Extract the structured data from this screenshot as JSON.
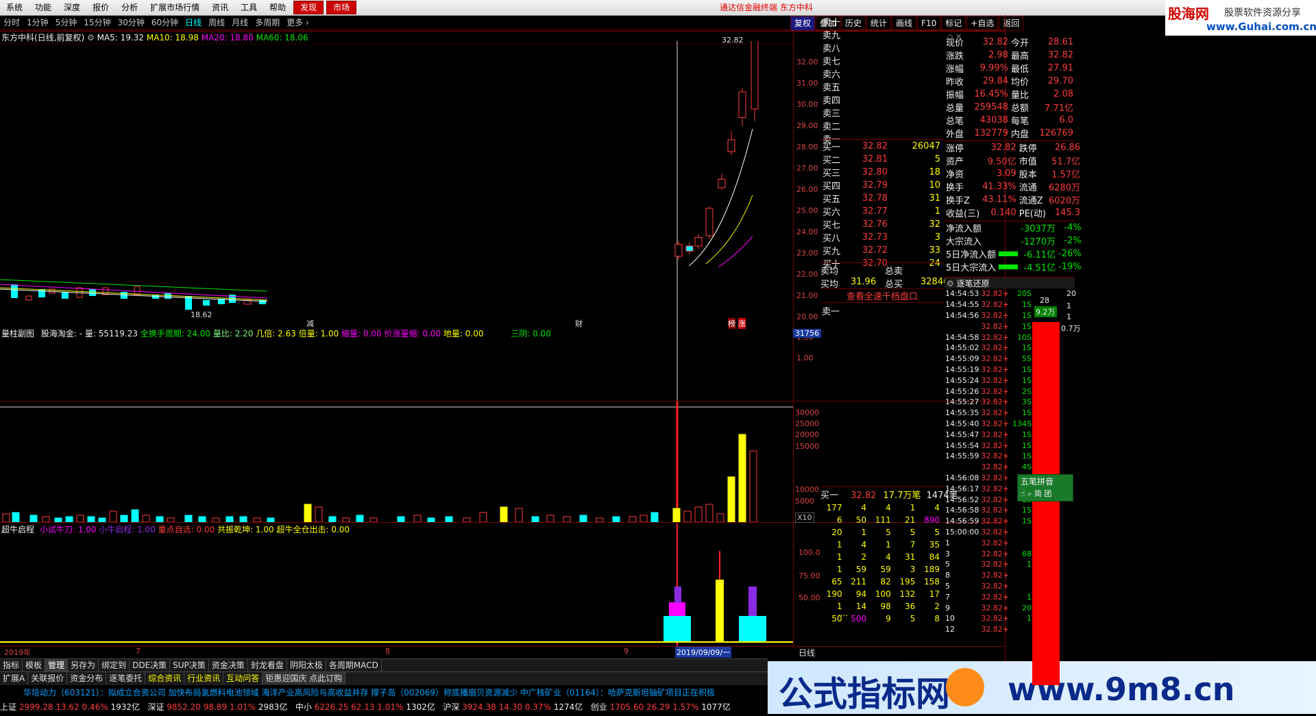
{
  "menubar": {
    "items": [
      "系统",
      "功能",
      "深度",
      "报价",
      "分析",
      "扩展市场行情",
      "资讯",
      "工具",
      "帮助"
    ],
    "tags": [
      "发现",
      "市场"
    ],
    "title": "通达信金融终端  东方中科"
  },
  "logo": {
    "brand": "股海网",
    "slogan": "股票软件资源分享",
    "url": "www.Guhai.com.cn"
  },
  "period_bar": {
    "items": [
      "分时",
      "1分钟",
      "5分钟",
      "15分钟",
      "30分钟",
      "60分钟",
      "日线",
      "周线",
      "月线",
      "多周期",
      "更多 ›"
    ],
    "active": "日线"
  },
  "right_buttons": [
    "复权",
    "叠加",
    "历史",
    "统计",
    "画线",
    "F10",
    "标记",
    "+自选",
    "返回"
  ],
  "chart_header": {
    "stock": "东方中科(日线,前复权)",
    "ma5": "MA5: 19.32",
    "ma10": "MA10: 18.98",
    "ma20": "MA20: 18.80",
    "ma60": "MA60: 18.06"
  },
  "price_axis": [
    "32.00",
    "31.00",
    "30.00",
    "29.00",
    "28.00",
    "27.00",
    "26.00",
    "25.00",
    "24.00",
    "23.00",
    "22.00",
    "21.00",
    "20.00",
    "1.00",
    "1.00"
  ],
  "price_marks": {
    "high": "32.82",
    "low": "18.62"
  },
  "event_marks": [
    "减",
    "财",
    "榜",
    "涨"
  ],
  "volume_header": {
    "title": "量柱副图",
    "text1": "股海淘金: -",
    "text2": "量: 55119.23",
    "text3": "全换手周期: 24.00",
    "text4": "量比: 2.20",
    "text5": "几倍: 2.63",
    "text6": "倍量: 1.00",
    "text7": "缩量: 0.00",
    "text8": "价涨量缩: 0.00",
    "text9": "地量: 0.00",
    "text10": "三阴: 0.00",
    "current": "31756",
    "unit": "X10"
  },
  "volume_axis": [
    "30000",
    "25000",
    "20000",
    "15000",
    "10000",
    "5000"
  ],
  "indicator_header": {
    "title": "超牛启程",
    "a": "小试牛刀: 1.00",
    "b": "小牛启程: 1.00",
    "c": "重点自选: 0.00",
    "d": "共振乾坤: 1.00",
    "e": "超牛全仓出击: 0.00"
  },
  "indicator_axis": [
    "100.0",
    "75.00",
    "50.00"
  ],
  "time_axis": {
    "labels": [
      "2019年",
      "7",
      "8",
      "9"
    ],
    "cursor": "2019/09/09/一",
    "period": "日线"
  },
  "chart_data": {
    "type": "candlestick",
    "title": "东方中科(日线,前复权)",
    "recent_candles": [
      {
        "open": 20.0,
        "close": 20.7,
        "high": 20.9,
        "low": 19.8
      },
      {
        "open": 20.3,
        "close": 20.6,
        "high": 20.8,
        "low": 20.1
      },
      {
        "open": 20.6,
        "close": 21.1,
        "high": 21.3,
        "low": 20.4
      },
      {
        "open": 21.2,
        "close": 22.8,
        "high": 22.9,
        "low": 21.0
      },
      {
        "open": 24.0,
        "close": 24.5,
        "high": 24.8,
        "low": 23.9
      },
      {
        "open": 26.1,
        "close": 26.8,
        "high": 27.3,
        "low": 25.9
      },
      {
        "open": 28.1,
        "close": 29.6,
        "high": 29.8,
        "low": 27.6
      },
      {
        "open": 28.6,
        "close": 32.82,
        "high": 32.82,
        "low": 27.9
      }
    ],
    "ylim": [
      18,
      33
    ]
  },
  "quote": {
    "ask_labels": [
      "卖十",
      "卖九",
      "卖八",
      "卖七",
      "卖六",
      "卖五",
      "卖四",
      "卖三",
      "卖二",
      "卖一"
    ],
    "bid_labels": [
      "买一",
      "买二",
      "买三",
      "买四",
      "买五",
      "买六",
      "买七",
      "买八",
      "买九",
      "买十"
    ],
    "bid_prices": [
      "32.82",
      "32.81",
      "32.80",
      "32.79",
      "32.78",
      "32.77",
      "32.76",
      "32.73",
      "32.72",
      "32.70"
    ],
    "bid_vols": [
      "26047",
      "5",
      "18",
      "10",
      "31",
      "1",
      "32",
      "3",
      "33",
      "24"
    ],
    "avg_sell_label": "卖均",
    "avg_buy_label": "买均",
    "avg_buy_price": "31.96",
    "total_sell_label": "总卖",
    "total_buy_label": "总买",
    "total_buy": "32846",
    "link": "查看全速千档盘口",
    "ask1_label": "卖一"
  },
  "stats": [
    [
      "现价",
      "32.82",
      "今开",
      "28.61"
    ],
    [
      "涨跌",
      "2.98",
      "最高",
      "32.82"
    ],
    [
      "涨幅",
      "9.99%",
      "最低",
      "27.91"
    ],
    [
      "昨收",
      "29.84",
      "均价",
      "29.70"
    ],
    [
      "振幅",
      "16.45%",
      "量比",
      "2.08"
    ],
    [
      "总量",
      "259548",
      "总额",
      "7.71亿"
    ],
    [
      "总笔",
      "43038",
      "每笔",
      "6.0"
    ],
    [
      "外盘",
      "132779",
      "内盘",
      "126769"
    ]
  ],
  "stats2": [
    [
      "涨停",
      "32.82",
      "跌停",
      "26.86"
    ],
    [
      "资产",
      "9.50亿",
      "市值",
      "51.7亿"
    ],
    [
      "净资",
      "3.09",
      "股本",
      "1.57亿"
    ],
    [
      "换手",
      "41.33%",
      "流通",
      "6280万"
    ],
    [
      "换手Z",
      "43.11%",
      "流通Z",
      "6020万"
    ],
    [
      "收益(三)",
      "0.140",
      "PE(动)",
      "145.3"
    ]
  ],
  "flows": [
    [
      "净流入额",
      "-3037万",
      "-4%"
    ],
    [
      "大宗流入",
      "-1270万",
      "-2%"
    ],
    [
      "5日净流入额",
      "-6.11亿",
      "-26%"
    ],
    [
      "5日大宗流入",
      "-4.51亿",
      "-19%"
    ]
  ],
  "queue": {
    "label": "买一",
    "price": "32.82",
    "qty": "17.7万笔",
    "count": "1474笔",
    "rows": [
      [
        "177",
        "4",
        "4",
        "1",
        "4"
      ],
      [
        "6",
        "50",
        "111",
        "21",
        "890"
      ],
      [
        "20",
        "1",
        "5",
        "5",
        "5"
      ],
      [
        "1",
        "4",
        "1",
        "7",
        "35"
      ],
      [
        "1",
        "2",
        "4",
        "31",
        "84"
      ],
      [
        "1",
        "59",
        "59",
        "3",
        "189"
      ],
      [
        "65",
        "211",
        "82",
        "195",
        "158"
      ],
      [
        "190",
        "94",
        "100",
        "132",
        "17"
      ],
      [
        "1",
        "14",
        "98",
        "36",
        "2"
      ],
      [
        "50",
        "500",
        "9",
        "5",
        "8"
      ]
    ],
    "more": "...."
  },
  "ticks": {
    "title": "逐笔还原",
    "rows": [
      [
        "14:54:53",
        "32.82+",
        "20S"
      ],
      [
        "14:54:55",
        "32.82+",
        "1S"
      ],
      [
        "14:54:56",
        "32.82+",
        "1S"
      ],
      [
        "",
        "32.82+",
        "1S"
      ],
      [
        "14:54:58",
        "32.82+",
        "10S"
      ],
      [
        "14:55:02",
        "32.82+",
        "1S"
      ],
      [
        "14:55:09",
        "32.82+",
        "5S"
      ],
      [
        "14:55:19",
        "32.82+",
        "1S"
      ],
      [
        "14:55:24",
        "32.82+",
        "1S"
      ],
      [
        "14:55:26",
        "32.82+",
        "2S"
      ],
      [
        "14:55:27",
        "32.82+",
        "3S"
      ],
      [
        "14:55:35",
        "32.82+",
        "1S"
      ],
      [
        "14:55:40",
        "32.82+",
        "134S"
      ],
      [
        "14:55:47",
        "32.82+",
        "1S"
      ],
      [
        "14:55:54",
        "32.82+",
        "1S"
      ],
      [
        "14:55:59",
        "32.82+",
        "1S"
      ],
      [
        "",
        "32.82+",
        "4S"
      ],
      [
        "14:56:08",
        "32.82+",
        "1S"
      ],
      [
        "14:56:17",
        "32.82+",
        "1S"
      ],
      [
        "14:56:52",
        "32.82+",
        "1S"
      ],
      [
        "14:56:58",
        "32.82+",
        "1S"
      ],
      [
        "14:56:59",
        "32.82+",
        "1S"
      ],
      [
        "15:00:00",
        "32.82+",
        ""
      ],
      [
        "1",
        "32.82+",
        ""
      ],
      [
        "3",
        "32.82+",
        "68"
      ],
      [
        "5",
        "32.82+",
        "1"
      ],
      [
        "8",
        "32.82+",
        ""
      ],
      [
        "5",
        "32.82+",
        ""
      ],
      [
        "7",
        "32.82+",
        "1"
      ],
      [
        "9",
        "32.82+",
        "20"
      ],
      [
        "10",
        "32.82+",
        "1"
      ],
      [
        "12",
        "32.82+",
        ""
      ]
    ],
    "side_values": [
      "28",
      "9.2万",
      "0.7万"
    ],
    "right_axis": [
      "20",
      "1",
      "1"
    ]
  },
  "floating_panel": {
    "title": "五笔拼音",
    "btn1": "简",
    "btn2": "团"
  },
  "bottom_tabs_row1": [
    "指标",
    "模板",
    "管理",
    "另存为",
    "绑定到",
    "DDE决策",
    "SUP决策",
    "资金决策",
    "封龙看盘",
    "阴阳太极",
    "各周期MACD"
  ],
  "bottom_tabs_row2": [
    "扩展A",
    "关联报价",
    "资金分布",
    "逐笔委托",
    "综合资讯",
    "行业资讯",
    "互动问答",
    "钜惠迎国庆 点此订购"
  ],
  "news": "华培动力（603121）：拟成立合资公司 加快布局氢燃料电池领域      海洋产业高风险与高收益并存 撑子岛（002069）称底播扇贝资源减少      中广核矿业（01164）：哈萨克斯坦铀矿项目正在积极",
  "status": [
    {
      "name": "上证",
      "val": "2999.28",
      "chg": "13.62",
      "pct": "0.46%",
      "amt": "1932亿"
    },
    {
      "name": "深证",
      "val": "9852.20",
      "chg": "98.89",
      "pct": "1.01%",
      "amt": "2983亿"
    },
    {
      "name": "中小",
      "val": "6226.25",
      "chg": "62.13",
      "pct": "1.01%",
      "amt": "1302亿"
    },
    {
      "name": "沪深",
      "val": "3924.38",
      "chg": "14.30",
      "pct": "0.37%",
      "amt": "1274亿"
    },
    {
      "name": "创业",
      "val": "1705.60",
      "chg": "26.29",
      "pct": "1.57%",
      "amt": "1077亿"
    }
  ],
  "watermark": {
    "text": "公式指标网",
    "url": "www.9m8.cn"
  },
  "colors": {
    "up": "#ff3c3c",
    "down": "#00ffff",
    "accent": "#ffff00",
    "panel_border": "#7a0000"
  }
}
